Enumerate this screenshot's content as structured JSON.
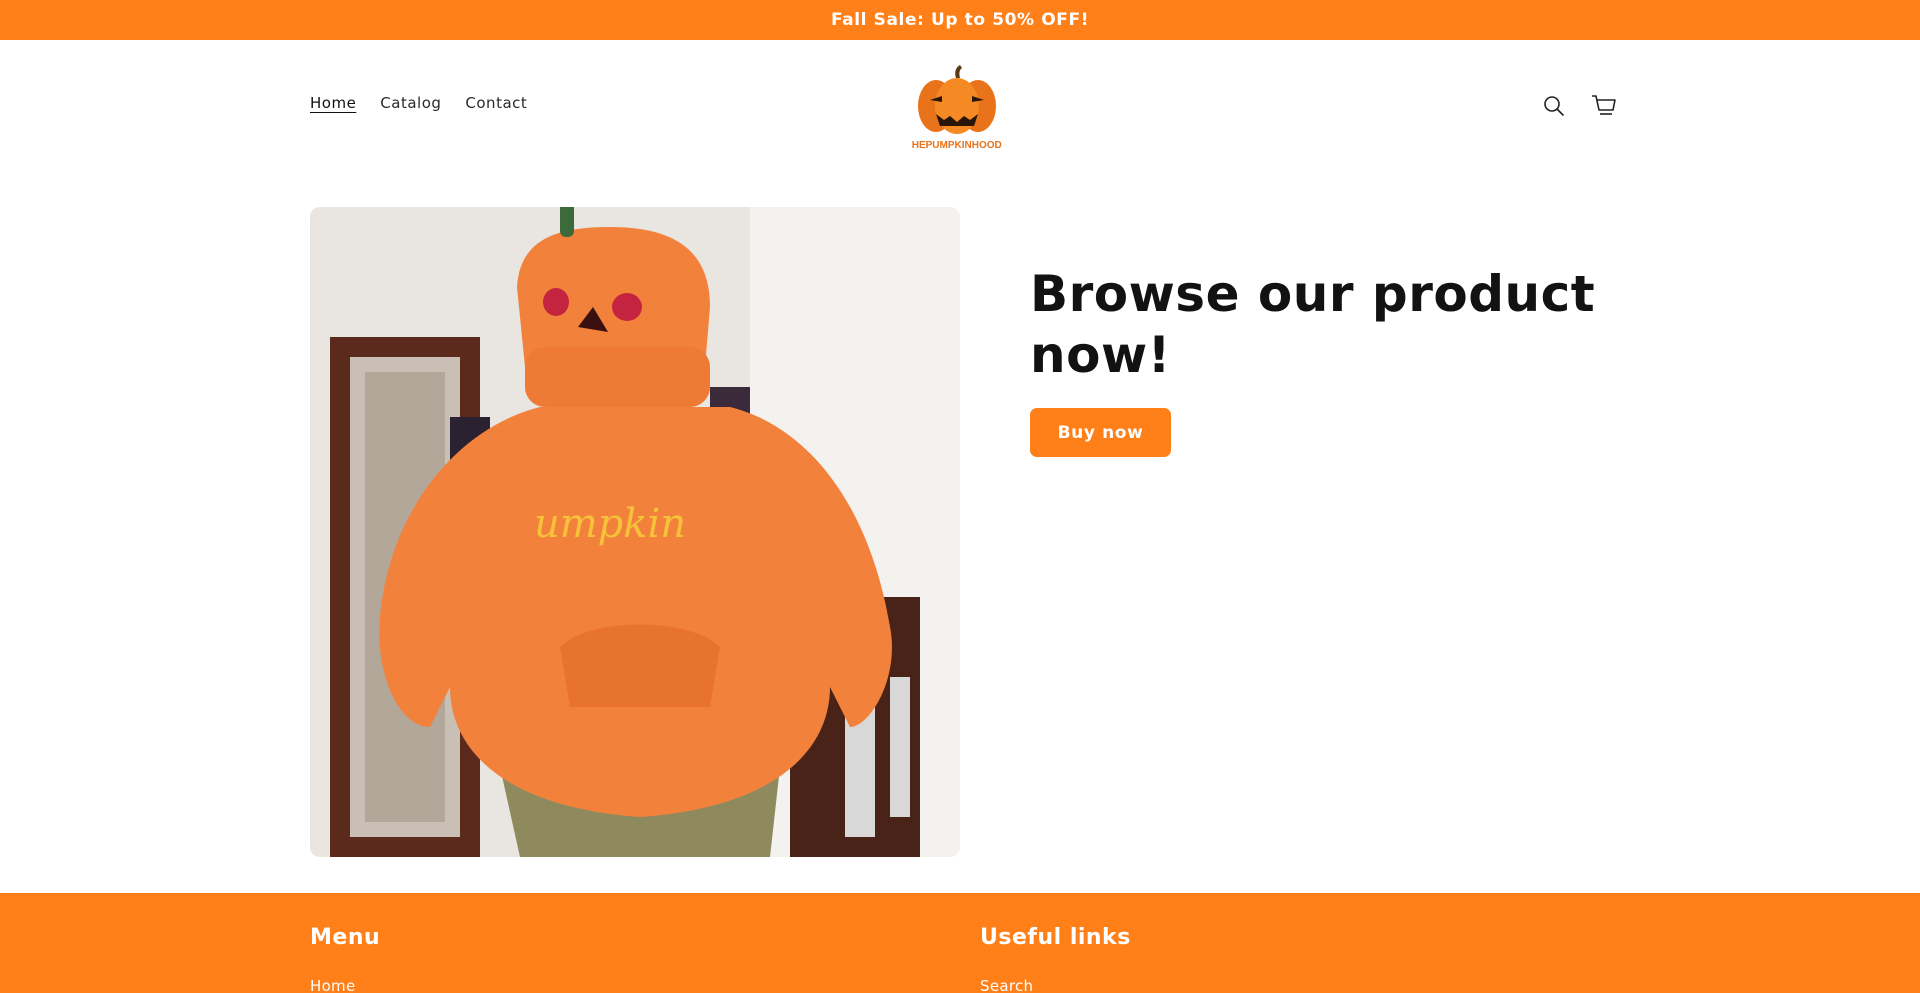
{
  "announcement": {
    "text": "Fall Sale: Up to 50% OFF!"
  },
  "header": {
    "nav": [
      {
        "label": "Home",
        "active": true
      },
      {
        "label": "Catalog",
        "active": false
      },
      {
        "label": "Contact",
        "active": false
      }
    ],
    "logo": {
      "text": "THEPUMPKINHOODY"
    },
    "icons": [
      "search-icon",
      "cart-icon"
    ]
  },
  "hero": {
    "title": "Browse our product now!",
    "button_label": "Buy now",
    "image": {
      "print_text": "umpkin"
    }
  },
  "footer": {
    "menu": {
      "heading": "Menu",
      "first_link": "Home"
    },
    "useful_links": {
      "heading": "Useful links",
      "first_link": "Search"
    }
  },
  "colors": {
    "accent": "#ff8019",
    "text": "#121212",
    "background": "#ffffff"
  }
}
